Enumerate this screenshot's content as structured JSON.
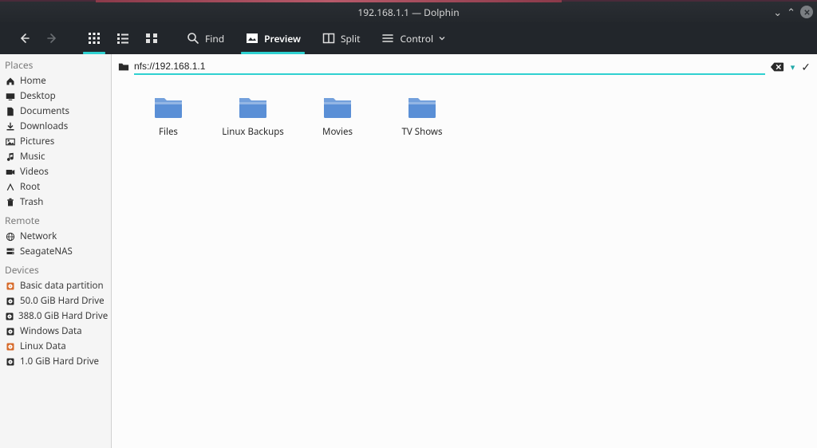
{
  "window": {
    "title": "192.168.1.1 — Dolphin"
  },
  "toolbar": {
    "find_label": "Find",
    "preview_label": "Preview",
    "split_label": "Split",
    "control_label": "Control"
  },
  "location": {
    "value": "nfs://192.168.1.1"
  },
  "sidebar": {
    "sections": [
      {
        "label": "Places",
        "items": [
          {
            "name": "Home",
            "icon": "home"
          },
          {
            "name": "Desktop",
            "icon": "desktop"
          },
          {
            "name": "Documents",
            "icon": "documents"
          },
          {
            "name": "Downloads",
            "icon": "downloads"
          },
          {
            "name": "Pictures",
            "icon": "pictures"
          },
          {
            "name": "Music",
            "icon": "music"
          },
          {
            "name": "Videos",
            "icon": "videos"
          },
          {
            "name": "Root",
            "icon": "root"
          },
          {
            "name": "Trash",
            "icon": "trash"
          }
        ]
      },
      {
        "label": "Remote",
        "items": [
          {
            "name": "Network",
            "icon": "network"
          },
          {
            "name": "SeagateNAS",
            "icon": "nas"
          }
        ]
      },
      {
        "label": "Devices",
        "items": [
          {
            "name": "Basic data partition",
            "icon": "disk-color"
          },
          {
            "name": "50.0 GiB Hard Drive",
            "icon": "disk"
          },
          {
            "name": "388.0 GiB Hard Drive",
            "icon": "disk"
          },
          {
            "name": "Windows Data",
            "icon": "disk"
          },
          {
            "name": "Linux Data",
            "icon": "disk-color"
          },
          {
            "name": "1.0 GiB Hard Drive",
            "icon": "disk"
          }
        ]
      }
    ]
  },
  "folders": [
    {
      "name": "Files"
    },
    {
      "name": "Linux Backups"
    },
    {
      "name": "Movies"
    },
    {
      "name": "TV Shows"
    }
  ],
  "colors": {
    "accent": "#2fd1d1",
    "folder": "#5a8fd6"
  }
}
